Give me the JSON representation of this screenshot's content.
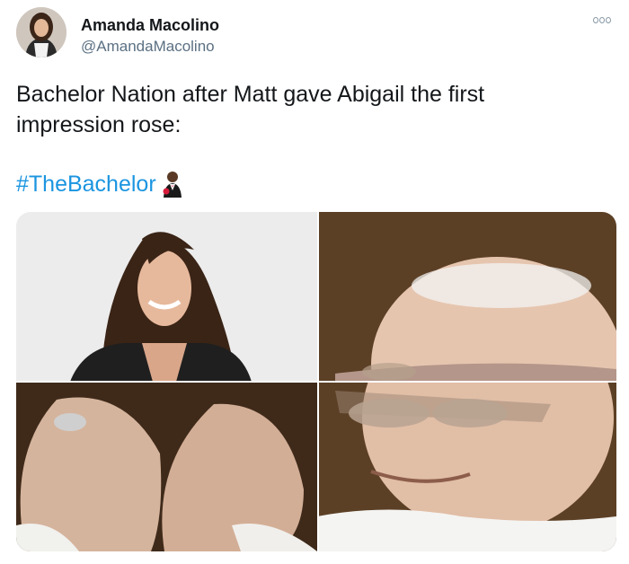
{
  "tweet": {
    "author_name": "Amanda Macolino",
    "author_handle": "@AmandaMacolino",
    "text": "Bachelor Nation after Matt gave Abigail the first impression rose:",
    "hashtag": "#TheBachelor",
    "emoji_icon": "man-in-tuxedo-emoji"
  },
  "colors": {
    "link": "#1b95e0",
    "handle": "#5b7083",
    "text": "#14171a"
  },
  "media": {
    "layout": "2x2 grid",
    "images": [
      {
        "name": "woman-portrait-image"
      },
      {
        "name": "man-closing-eyes-top-image"
      },
      {
        "name": "hands-holding-image"
      },
      {
        "name": "man-closing-eyes-bottom-image"
      }
    ]
  }
}
